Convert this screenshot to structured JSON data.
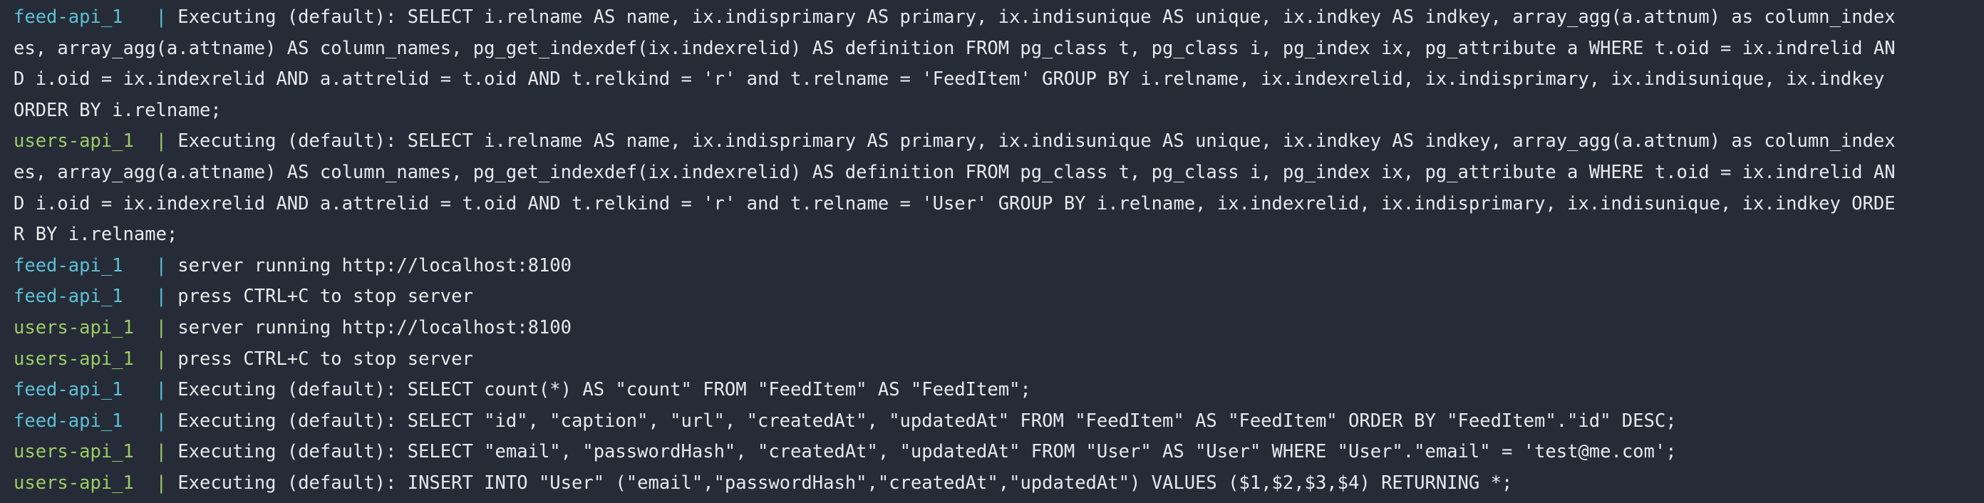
{
  "colors": {
    "background": "#262c37",
    "text": "#e6e9ee",
    "feed_service": "#5bc0d6",
    "users_service": "#9ccc65"
  },
  "lines": [
    {
      "service": "feed-api_1",
      "pad": "   ",
      "pipe": "|",
      "text": " Executing (default): SELECT i.relname AS name, ix.indisprimary AS primary, ix.indisunique AS unique, ix.indkey AS indkey, array_agg(a.attnum) as column_index",
      "kind": "feed"
    },
    {
      "service": "",
      "pad": "",
      "pipe": "",
      "text": "es, array_agg(a.attname) AS column_names, pg_get_indexdef(ix.indexrelid) AS definition FROM pg_class t, pg_class i, pg_index ix, pg_attribute a WHERE t.oid = ix.indrelid AN",
      "kind": "cont"
    },
    {
      "service": "",
      "pad": "",
      "pipe": "",
      "text": "D i.oid = ix.indexrelid AND a.attrelid = t.oid AND t.relkind = 'r' and t.relname = 'FeedItem' GROUP BY i.relname, ix.indexrelid, ix.indisprimary, ix.indisunique, ix.indkey",
      "kind": "cont"
    },
    {
      "service": "",
      "pad": "",
      "pipe": "",
      "text": "ORDER BY i.relname;",
      "kind": "cont"
    },
    {
      "service": "users-api_1",
      "pad": "  ",
      "pipe": "|",
      "text": " Executing (default): SELECT i.relname AS name, ix.indisprimary AS primary, ix.indisunique AS unique, ix.indkey AS indkey, array_agg(a.attnum) as column_index",
      "kind": "users"
    },
    {
      "service": "",
      "pad": "",
      "pipe": "",
      "text": "es, array_agg(a.attname) AS column_names, pg_get_indexdef(ix.indexrelid) AS definition FROM pg_class t, pg_class i, pg_index ix, pg_attribute a WHERE t.oid = ix.indrelid AN",
      "kind": "cont"
    },
    {
      "service": "",
      "pad": "",
      "pipe": "",
      "text": "D i.oid = ix.indexrelid AND a.attrelid = t.oid AND t.relkind = 'r' and t.relname = 'User' GROUP BY i.relname, ix.indexrelid, ix.indisprimary, ix.indisunique, ix.indkey ORDE",
      "kind": "cont"
    },
    {
      "service": "",
      "pad": "",
      "pipe": "",
      "text": "R BY i.relname;",
      "kind": "cont"
    },
    {
      "service": "feed-api_1",
      "pad": "   ",
      "pipe": "|",
      "text": " server running http://localhost:8100",
      "kind": "feed"
    },
    {
      "service": "feed-api_1",
      "pad": "   ",
      "pipe": "|",
      "text": " press CTRL+C to stop server",
      "kind": "feed"
    },
    {
      "service": "users-api_1",
      "pad": "  ",
      "pipe": "|",
      "text": " server running http://localhost:8100",
      "kind": "users"
    },
    {
      "service": "users-api_1",
      "pad": "  ",
      "pipe": "|",
      "text": " press CTRL+C to stop server",
      "kind": "users"
    },
    {
      "service": "feed-api_1",
      "pad": "   ",
      "pipe": "|",
      "text": " Executing (default): SELECT count(*) AS \"count\" FROM \"FeedItem\" AS \"FeedItem\";",
      "kind": "feed"
    },
    {
      "service": "feed-api_1",
      "pad": "   ",
      "pipe": "|",
      "text": " Executing (default): SELECT \"id\", \"caption\", \"url\", \"createdAt\", \"updatedAt\" FROM \"FeedItem\" AS \"FeedItem\" ORDER BY \"FeedItem\".\"id\" DESC;",
      "kind": "feed"
    },
    {
      "service": "users-api_1",
      "pad": "  ",
      "pipe": "|",
      "text": " Executing (default): SELECT \"email\", \"passwordHash\", \"createdAt\", \"updatedAt\" FROM \"User\" AS \"User\" WHERE \"User\".\"email\" = 'test@me.com';",
      "kind": "users"
    },
    {
      "service": "users-api_1",
      "pad": "  ",
      "pipe": "|",
      "text": " Executing (default): INSERT INTO \"User\" (\"email\",\"passwordHash\",\"createdAt\",\"updatedAt\") VALUES ($1,$2,$3,$4) RETURNING *;",
      "kind": "users"
    }
  ]
}
